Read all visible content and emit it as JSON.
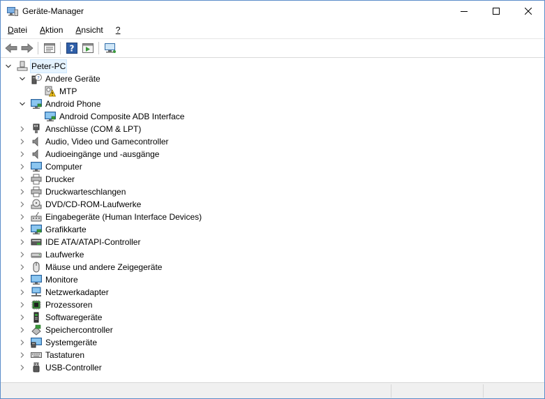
{
  "window": {
    "title": "Geräte-Manager",
    "accent": "#5b8cc9"
  },
  "menu": [
    {
      "label": "Datei",
      "u": "D",
      "rest": "atei",
      "name": "menu-datei"
    },
    {
      "label": "Aktion",
      "u": "A",
      "rest": "ktion",
      "name": "menu-aktion"
    },
    {
      "label": "Ansicht",
      "u": "A",
      "rest": "nsicht",
      "name": "menu-ansicht"
    },
    {
      "label": "?",
      "u": "?",
      "rest": "",
      "name": "menu-help"
    }
  ],
  "toolbar": [
    {
      "icon": "back-arrow-icon"
    },
    {
      "icon": "forward-arrow-icon"
    },
    {
      "sep": true
    },
    {
      "icon": "properties-icon"
    },
    {
      "sep": true
    },
    {
      "icon": "help-icon"
    },
    {
      "icon": "view-icon"
    },
    {
      "sep": true
    },
    {
      "icon": "monitor-network-icon"
    }
  ],
  "tree": {
    "root": "Peter-PC",
    "nodes": [
      {
        "label": "Andere Geräte",
        "level": 1,
        "state": "expanded",
        "icon": "unknown-device-icon"
      },
      {
        "label": "MTP",
        "level": 2,
        "state": "leaf",
        "icon": "warning-device-icon"
      },
      {
        "label": "Android Phone",
        "level": 1,
        "state": "expanded",
        "icon": "android-phone-icon"
      },
      {
        "label": "Android Composite ADB Interface",
        "level": 2,
        "state": "leaf",
        "icon": "adb-interface-icon"
      },
      {
        "label": "Anschlüsse (COM & LPT)",
        "level": 1,
        "state": "collapsed",
        "icon": "port-icon"
      },
      {
        "label": "Audio, Video und Gamecontroller",
        "level": 1,
        "state": "collapsed",
        "icon": "speaker-icon"
      },
      {
        "label": "Audioeingänge und -ausgänge",
        "level": 1,
        "state": "collapsed",
        "icon": "speaker-icon"
      },
      {
        "label": "Computer",
        "level": 1,
        "state": "collapsed",
        "icon": "computer-icon"
      },
      {
        "label": "Drucker",
        "level": 1,
        "state": "collapsed",
        "icon": "printer-icon"
      },
      {
        "label": "Druckwarteschlangen",
        "level": 1,
        "state": "collapsed",
        "icon": "printer-icon"
      },
      {
        "label": "DVD/CD-ROM-Laufwerke",
        "level": 1,
        "state": "collapsed",
        "icon": "disc-drive-icon"
      },
      {
        "label": "Eingabegeräte (Human Interface Devices)",
        "level": 1,
        "state": "collapsed",
        "icon": "hid-icon"
      },
      {
        "label": "Grafikkarte",
        "level": 1,
        "state": "collapsed",
        "icon": "display-adapter-icon"
      },
      {
        "label": "IDE ATA/ATAPI-Controller",
        "level": 1,
        "state": "collapsed",
        "icon": "ide-controller-icon"
      },
      {
        "label": "Laufwerke",
        "level": 1,
        "state": "collapsed",
        "icon": "disk-drive-icon"
      },
      {
        "label": "Mäuse und andere Zeigegeräte",
        "level": 1,
        "state": "collapsed",
        "icon": "mouse-icon"
      },
      {
        "label": "Monitore",
        "level": 1,
        "state": "collapsed",
        "icon": "monitor-icon"
      },
      {
        "label": "Netzwerkadapter",
        "level": 1,
        "state": "collapsed",
        "icon": "network-adapter-icon"
      },
      {
        "label": "Prozessoren",
        "level": 1,
        "state": "collapsed",
        "icon": "processor-icon"
      },
      {
        "label": "Softwaregeräte",
        "level": 1,
        "state": "collapsed",
        "icon": "software-device-icon"
      },
      {
        "label": "Speichercontroller",
        "level": 1,
        "state": "collapsed",
        "icon": "storage-controller-icon"
      },
      {
        "label": "Systemgeräte",
        "level": 1,
        "state": "collapsed",
        "icon": "system-device-icon"
      },
      {
        "label": "Tastaturen",
        "level": 1,
        "state": "collapsed",
        "icon": "keyboard-icon"
      },
      {
        "label": "USB-Controller",
        "level": 1,
        "state": "collapsed",
        "icon": "usb-icon"
      }
    ]
  }
}
